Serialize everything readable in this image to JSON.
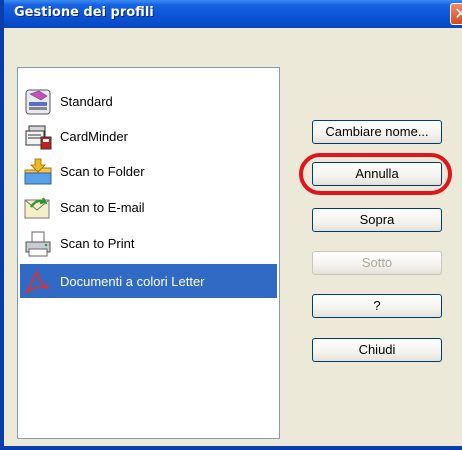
{
  "window": {
    "title": "Gestione dei profili",
    "close_label": "✕"
  },
  "profiles": {
    "items": [
      {
        "label": "Standard",
        "icon": "business-card-organizer-icon"
      },
      {
        "label": "CardMinder",
        "icon": "cardminder-icon"
      },
      {
        "label": "Scan to Folder",
        "icon": "folder-arrow-icon"
      },
      {
        "label": "Scan to E-mail",
        "icon": "email-envelope-icon"
      },
      {
        "label": "Scan to Print",
        "icon": "printer-icon"
      },
      {
        "label": "Documenti a colori Letter",
        "icon": "acrobat-pdf-icon",
        "selected": true
      }
    ]
  },
  "buttons": {
    "rename": "Cambiare nome...",
    "cancel": "Annulla",
    "up": "Sopra",
    "down": "Sotto",
    "help": "?",
    "close": "Chiudi"
  },
  "colors": {
    "selection": "#316ac5",
    "highlight_ring": "#e0141c",
    "titlebar": "#0a53d6"
  }
}
